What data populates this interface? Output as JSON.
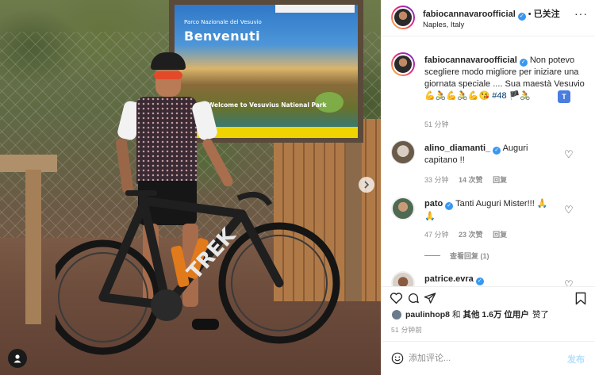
{
  "post": {
    "username": "fabiocannavaroofficial",
    "follow_state": "已关注",
    "location": "Naples, Italy"
  },
  "image": {
    "sign": {
      "park_name": "Parco Nazionale del Vesuvio",
      "welcome_it": "Benvenuti",
      "welcome_en": "Welcome to Vesuvius National Park"
    },
    "bike_brand": "TREK"
  },
  "caption": {
    "username": "fabiocannavaroofficial",
    "text": "Non potevo scegliere modo migliore per iniziare una giornata speciale .... Sua maestà Vesuvio",
    "emojis": "💪🚴💪🚴💪😘",
    "hashtag": "#48",
    "emojis2": "🏴🚴",
    "time": "51 分钟",
    "translate_icon": "translate-icon"
  },
  "comments": [
    {
      "username": "alino_diamanti_",
      "verified": true,
      "text": "Auguri capitano !!",
      "time": "33 分钟",
      "likes": "14 次赞",
      "reply": "回复"
    },
    {
      "username": "pato",
      "verified": true,
      "text": "Tanti Auguri Mister!!! 🙏",
      "emoji_line": "🙏",
      "time": "47 分钟",
      "likes": "23 次赞",
      "reply": "回复",
      "view_replies": "查看回复 (1)"
    },
    {
      "username": "patrice.evra",
      "verified": true
    }
  ],
  "likes": {
    "user": "paulinhop8",
    "and": "和",
    "others": "其他 1.6万 位用户",
    "suffix": "赞了"
  },
  "timestamp": "51 分钟前",
  "add_comment": {
    "placeholder": "添加评论...",
    "post_label": "发布"
  }
}
